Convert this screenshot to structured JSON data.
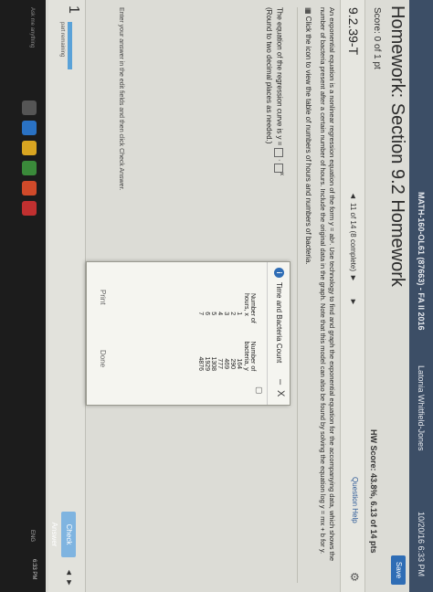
{
  "header": {
    "course": "MATH-160-OL61 (87663) - FA II 2016",
    "user": "Latonia Whitfield-Jones",
    "time": "10/20/16 6:33 PM",
    "save": "Save"
  },
  "title": "Homework: Section 9.2 Homework",
  "score": "Score: 0 of 1 pt",
  "hw_score": "HW Score: 43.8%, 6.13 of 14 pts",
  "nav": {
    "question": "9.2.39-T",
    "prev": "◄",
    "progress": "11 of 14 (8 complete)",
    "next": "►",
    "next2": "►",
    "question_help": "Question Help",
    "gear": "⚙"
  },
  "problem": {
    "text": "An exponential equation is a nonlinear regression equation of the form y = abˣ. Use technology to find and graph the exponential equation for the accompanying data, which shows the number of bacteria present after a certain number of hours. Include the original data in the graph. Note that this model can also be found by solving the equation log y = mx + b for y.",
    "click_icon": "Click the icon to view the table of numbers of hours and numbers of bacteria.",
    "eq_line1": "The equation of the regression curve is y =",
    "eq_line2": "(Round to two decimal places as needed.)",
    "enter": "Enter your answer in the edit fields and then click Check Answer."
  },
  "footer": {
    "part_num": "1",
    "part_label": "part remaining",
    "check": "Check Answer"
  },
  "modal": {
    "title": "Time and Bacteria Count",
    "min": "–",
    "close": "X",
    "col_x": "Number of hours, x",
    "col_y": "Number of bacteria, y",
    "rows": [
      {
        "x": "1",
        "y": "164"
      },
      {
        "x": "2",
        "y": "290"
      },
      {
        "x": "3",
        "y": "469"
      },
      {
        "x": "4",
        "y": "777"
      },
      {
        "x": "5",
        "y": "1308"
      },
      {
        "x": "6",
        "y": "1929"
      },
      {
        "x": "7",
        "y": "4876"
      }
    ],
    "print": "Print",
    "done": "Done"
  },
  "taskbar": {
    "ask": "Ask me anything",
    "time": "6:33 PM",
    "lang": "ENG"
  },
  "colors": {
    "topbar": "#3c4e66",
    "accent": "#2f6db5"
  }
}
